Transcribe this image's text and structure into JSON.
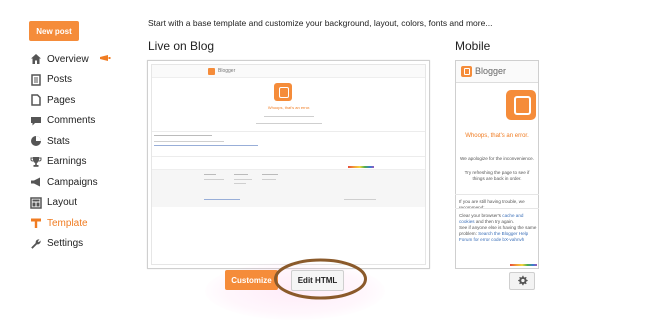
{
  "sidebar": {
    "new_post_label": "New post",
    "items": [
      {
        "label": "Overview",
        "icon": "home-icon",
        "active": false
      },
      {
        "label": "Posts",
        "icon": "posts-icon",
        "active": false
      },
      {
        "label": "Pages",
        "icon": "pages-icon",
        "active": false
      },
      {
        "label": "Comments",
        "icon": "comments-icon",
        "active": false
      },
      {
        "label": "Stats",
        "icon": "stats-icon",
        "active": false
      },
      {
        "label": "Earnings",
        "icon": "trophy-icon",
        "active": false
      },
      {
        "label": "Campaigns",
        "icon": "megaphone-icon",
        "active": false
      },
      {
        "label": "Layout",
        "icon": "layout-icon",
        "active": false
      },
      {
        "label": "Template",
        "icon": "template-icon",
        "active": true
      },
      {
        "label": "Settings",
        "icon": "wrench-icon",
        "active": false
      }
    ]
  },
  "main": {
    "intro": "Start with a base template and customize your background, layout, colors, fonts and more...",
    "live_title": "Live on Blog",
    "mobile_title": "Mobile",
    "customize_label": "Customize",
    "edit_html_label": "Edit HTML"
  },
  "live_preview": {
    "brand": "Blogger",
    "error_title": "Whoops, that's an error."
  },
  "mobile_preview": {
    "brand": "Blogger",
    "error_title": "Whoops, that's an error.",
    "apology": "We apologize for the inconvenience.",
    "retry": "Try refreshing the page to see if things are back in order.",
    "still_trouble": "If you are still having trouble, we recommend:",
    "clear_prefix": "Clear your browser's ",
    "clear_link": "cache and cookies",
    "clear_suffix": " and then try again.",
    "see_prefix": "See if anyone else is having the same problem: ",
    "see_link": "Search the Blogger Help Forum for error code bX-vahnvh"
  },
  "colors": {
    "accent": "#f58c3a",
    "active_text": "#f07c22",
    "highlight_ring": "#8b5a2b",
    "link": "#3b6fb8"
  }
}
